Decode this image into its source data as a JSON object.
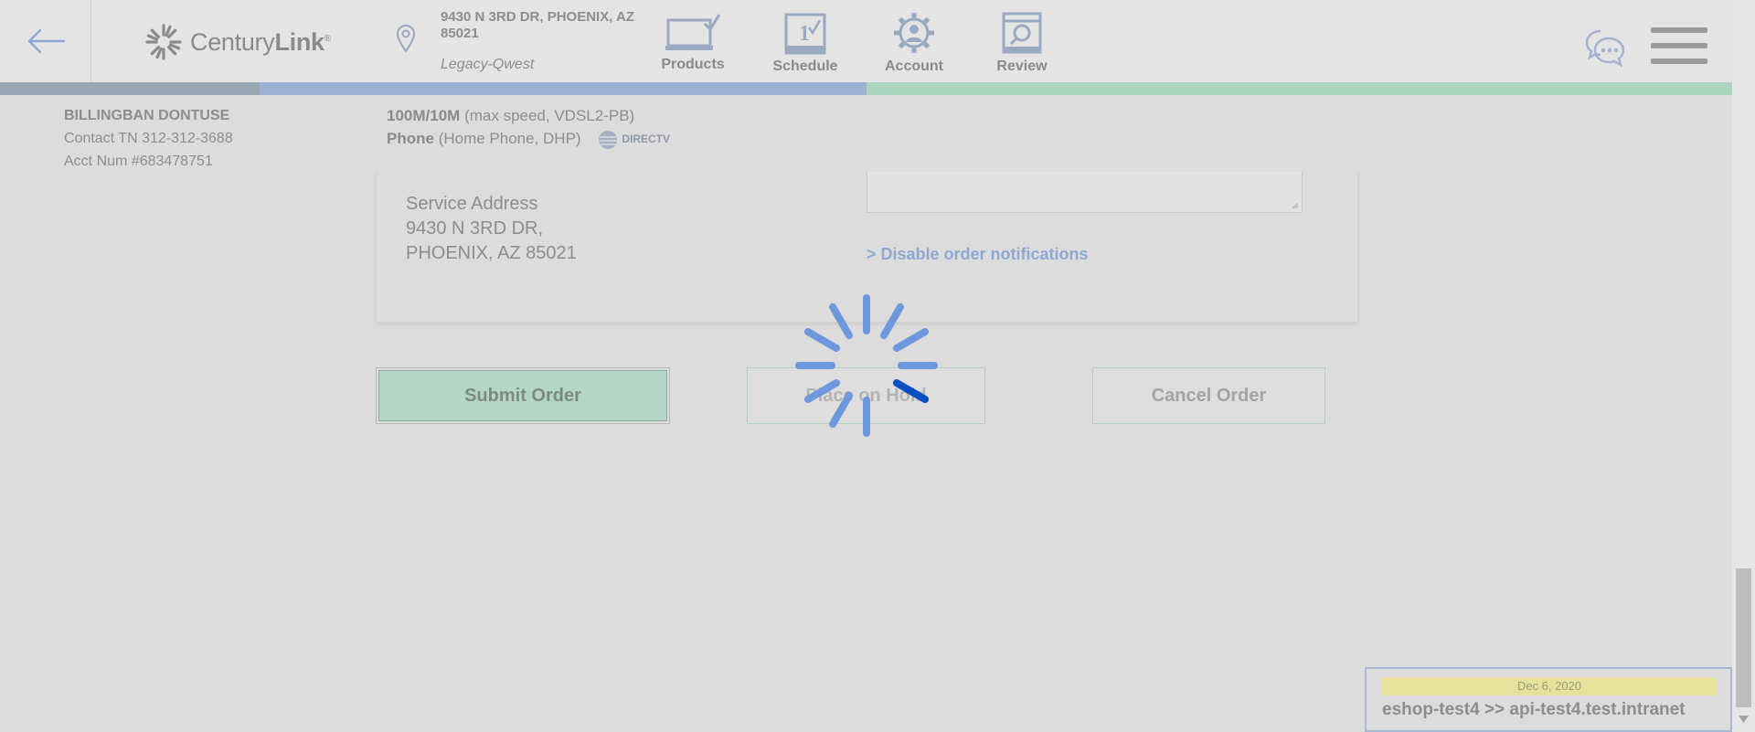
{
  "header": {
    "brand": "CenturyLink",
    "address_line": "9430 N 3RD DR, PHOENIX, AZ 85021",
    "address_sub": "Legacy-Qwest",
    "nav": [
      {
        "label": "Products",
        "icon": "monitor-check-icon"
      },
      {
        "label": "Schedule",
        "icon": "calendar-check-icon"
      },
      {
        "label": "Account",
        "icon": "gear-user-icon"
      },
      {
        "label": "Review",
        "icon": "document-search-icon"
      }
    ]
  },
  "progress": {
    "segments": 3
  },
  "customer": {
    "name": "BILLINGBAN DONTUSE",
    "contact": "Contact TN 312-312-3688",
    "account": "Acct Num #683478751"
  },
  "plan": {
    "speed": "100M/10M",
    "speed_detail": "(max speed, VDSL2-PB)",
    "phone": "Phone",
    "phone_detail": "(Home Phone, DHP)",
    "partner": "DIRECTV"
  },
  "card": {
    "service_address_label": "Service Address",
    "service_address_line1": "9430 N 3RD DR,",
    "service_address_line2": "PHOENIX, AZ 85021",
    "disable_notifications": "> Disable order notifications"
  },
  "buttons": {
    "submit": "Submit Order",
    "hold": "Place on Hold",
    "cancel": "Cancel Order"
  },
  "env": {
    "date": "Dec 6, 2020",
    "host": "eshop-test4 >> api-test4.test.intranet"
  },
  "colors": {
    "accent_blue": "#8ea8d3",
    "spinner_blue": "#6e98de",
    "spinner_dark": "#0b4fc4",
    "submit_green": "#b4d6c6"
  }
}
